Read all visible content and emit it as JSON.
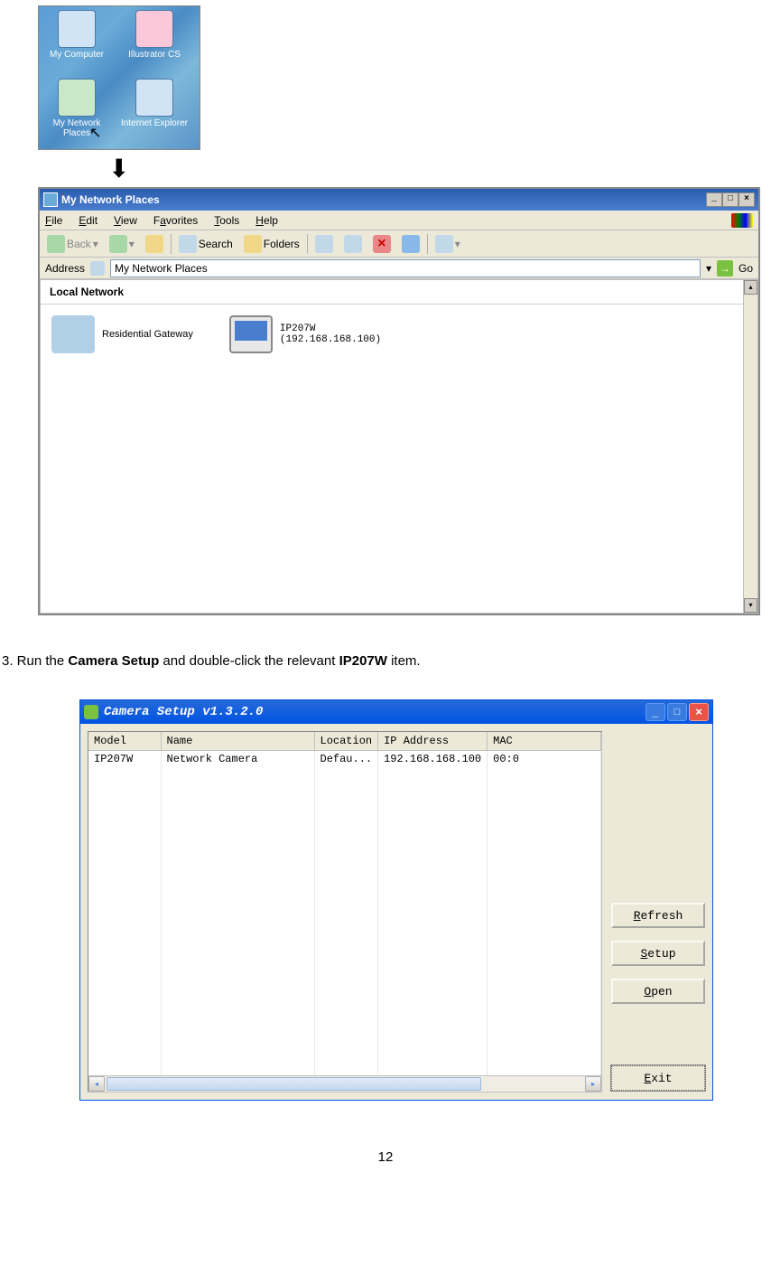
{
  "desktop": {
    "icons": {
      "my_computer": "My Computer",
      "illustrator": "Illustrator CS",
      "network_places": "My Network Places",
      "ie": "Internet Explorer"
    }
  },
  "mnp": {
    "title": "My Network Places",
    "menu": {
      "file": "File",
      "edit": "Edit",
      "view": "View",
      "favorites": "Favorites",
      "tools": "Tools",
      "help": "Help"
    },
    "toolbar": {
      "back": "Back",
      "search": "Search",
      "folders": "Folders"
    },
    "address_label": "Address",
    "address_value": "My Network Places",
    "go": "Go",
    "group": "Local Network",
    "items": {
      "gateway": "Residential Gateway",
      "camera_name": "IP207W",
      "camera_ip": "(192.168.168.100)"
    }
  },
  "instruction": {
    "prefix": "3. Run the ",
    "b1": "Camera Setup",
    "mid": " and double-click the relevant ",
    "b2": "IP207W",
    "suffix": " item."
  },
  "cam": {
    "title": "Camera Setup v1.3.2.0",
    "columns": {
      "model": "Model",
      "name": "Name",
      "location": "Location",
      "ip": "IP Address",
      "mac": "MAC"
    },
    "row": {
      "model": "IP207W",
      "name": "Network Camera",
      "location": "Defau...",
      "ip": "192.168.168.100",
      "mac": "00:0"
    },
    "buttons": {
      "refresh": "efresh",
      "refresh_u": "R",
      "setup": "etup",
      "setup_u": "S",
      "open": "pen",
      "open_u": "O",
      "exit": "xit",
      "exit_u": "E"
    }
  },
  "page_number": "12"
}
